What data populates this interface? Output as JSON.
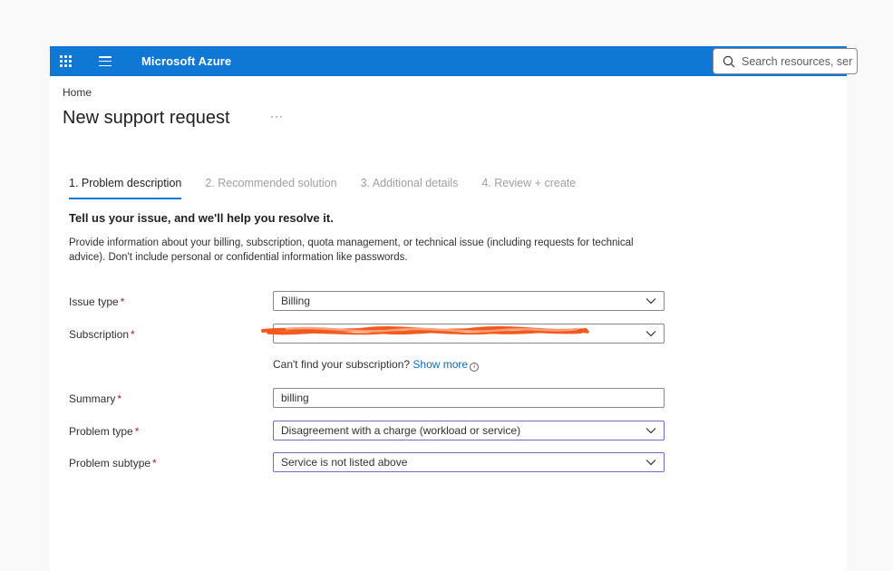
{
  "topbar": {
    "brand": "Microsoft Azure",
    "search_placeholder": "Search resources, ser"
  },
  "breadcrumb": {
    "home": "Home"
  },
  "page": {
    "title": "New support request",
    "more": "···"
  },
  "tabs": [
    {
      "label": "1. Problem description",
      "active": true
    },
    {
      "label": "2. Recommended solution",
      "active": false
    },
    {
      "label": "3. Additional details",
      "active": false
    },
    {
      "label": "4. Review + create",
      "active": false
    }
  ],
  "intro": {
    "heading": "Tell us your issue, and we'll help you resolve it.",
    "text": "Provide information about your billing, subscription, quota management, or technical issue (including requests for technical advice). Don't include personal or confidential information like passwords."
  },
  "form": {
    "issue_type": {
      "label": "Issue type",
      "required": "*",
      "value": "Billing"
    },
    "subscription": {
      "label": "Subscription",
      "required": "*",
      "value": ""
    },
    "helper": {
      "text": "Can't find your subscription?",
      "link": "Show more",
      "info": "i"
    },
    "summary": {
      "label": "Summary",
      "required": "*",
      "value": "billing"
    },
    "problem_type": {
      "label": "Problem type",
      "required": "*",
      "value": "Disagreement with a charge (workload or service)"
    },
    "problem_subtype": {
      "label": "Problem subtype",
      "required": "*",
      "value": "Service is not listed above"
    }
  },
  "colors": {
    "brand_blue": "#0f78d4",
    "required_red": "#a4262c",
    "focused_border": "#8661c5",
    "redaction_orange": "#f25a1d"
  }
}
